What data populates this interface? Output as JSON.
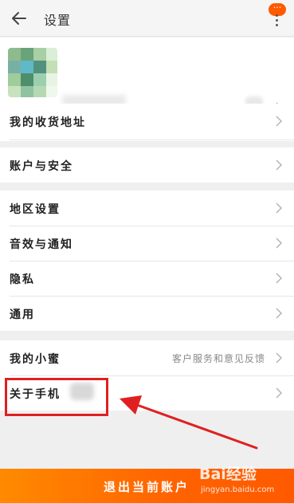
{
  "header": {
    "title": "设置",
    "badge": "···"
  },
  "profile": {
    "avatar_colors": [
      "#8dbb8e",
      "#6aa37a",
      "#a9cfa5",
      "#52917d",
      "#79b0a6",
      "#5fb9c8",
      "#c3dfb6",
      "#4f8e6c",
      "#9ccfae"
    ]
  },
  "groups": [
    {
      "rows": [
        {
          "label": "我的收货地址"
        }
      ]
    },
    {
      "rows": [
        {
          "label": "账户与安全"
        }
      ]
    },
    {
      "rows": [
        {
          "label": "地区设置"
        },
        {
          "label": "音效与通知"
        },
        {
          "label": "隐私"
        },
        {
          "label": "通用"
        }
      ]
    },
    {
      "rows": [
        {
          "label": "我的小蜜",
          "sub": "客户服务和意见反馈"
        },
        {
          "label": "关于手机"
        }
      ]
    }
  ],
  "logout": {
    "label": "退出当前账户"
  },
  "watermark": {
    "logo": "Bai经验",
    "url": "jingyan.baidu.com"
  },
  "colors": {
    "accent": "#ff6200",
    "annotation": "#e02020"
  }
}
